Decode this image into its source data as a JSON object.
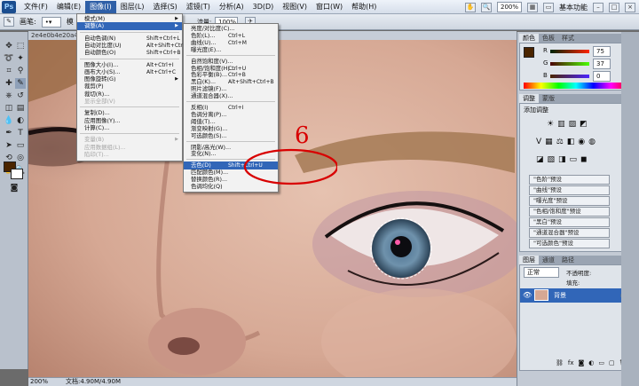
{
  "app": {
    "logo": "Ps"
  },
  "menubar": {
    "items": [
      "文件(F)",
      "编辑(E)",
      "图像(I)",
      "图层(L)",
      "选择(S)",
      "滤镜(T)",
      "分析(A)",
      "3D(D)",
      "视图(V)",
      "窗口(W)",
      "帮助(H)"
    ],
    "active_index": 2,
    "zoom": "200%",
    "workspace": "基本功能"
  },
  "options_bar": {
    "brush_label": "画笔:",
    "mode_label": "模",
    "flow_label": "流量:",
    "flow_value": "100%"
  },
  "document": {
    "tab": "2e4e0b4e20a446",
    "status_zoom": "200%",
    "status_doc": "文档:4.90M/4.90M"
  },
  "annotation": {
    "step": "6"
  },
  "image_menu": [
    {
      "label": "模式(M)",
      "shortcut": "",
      "arrow": true,
      "state": "normal"
    },
    {
      "label": "调整(A)",
      "shortcut": "",
      "arrow": true,
      "state": "highlight"
    },
    {
      "label": "自动色调(N)",
      "shortcut": "Shift+Ctrl+L",
      "state": "normal"
    },
    {
      "label": "自动对比度(U)",
      "shortcut": "Alt+Shift+Ctrl+L",
      "state": "normal"
    },
    {
      "label": "自动颜色(O)",
      "shortcut": "Shift+Ctrl+B",
      "state": "normal"
    },
    {
      "label": "图像大小(I)...",
      "shortcut": "Alt+Ctrl+I",
      "state": "normal"
    },
    {
      "label": "画布大小(S)...",
      "shortcut": "Alt+Ctrl+C",
      "state": "normal"
    },
    {
      "label": "图像旋转(G)",
      "shortcut": "",
      "arrow": true,
      "state": "normal"
    },
    {
      "label": "裁剪(P)",
      "shortcut": "",
      "state": "normal"
    },
    {
      "label": "裁切(R)...",
      "shortcut": "",
      "state": "normal"
    },
    {
      "label": "显示全部(V)",
      "shortcut": "",
      "state": "disabled"
    },
    {
      "label": "复制(D)...",
      "shortcut": "",
      "state": "normal"
    },
    {
      "label": "应用图像(Y)...",
      "shortcut": "",
      "state": "normal"
    },
    {
      "label": "计算(C)...",
      "shortcut": "",
      "state": "normal"
    },
    {
      "label": "变量(B)",
      "shortcut": "",
      "arrow": true,
      "state": "disabled"
    },
    {
      "label": "应用数据组(L)...",
      "shortcut": "",
      "state": "disabled"
    },
    {
      "label": "陷印(T)...",
      "shortcut": "",
      "state": "disabled"
    }
  ],
  "adjust_menu": [
    {
      "label": "亮度/对比度(C)...",
      "shortcut": "",
      "state": "normal"
    },
    {
      "label": "色阶(L)...",
      "shortcut": "Ctrl+L",
      "state": "normal"
    },
    {
      "label": "曲线(U)...",
      "shortcut": "Ctrl+M",
      "state": "normal"
    },
    {
      "label": "曝光度(E)...",
      "shortcut": "",
      "state": "normal"
    },
    {
      "label": "自然饱和度(V)...",
      "shortcut": "",
      "state": "normal"
    },
    {
      "label": "色相/饱和度(H)...",
      "shortcut": "Ctrl+U",
      "state": "normal"
    },
    {
      "label": "色彩平衡(B)...",
      "shortcut": "Ctrl+B",
      "state": "normal"
    },
    {
      "label": "黑白(K)...",
      "shortcut": "Alt+Shift+Ctrl+B",
      "state": "normal"
    },
    {
      "label": "照片滤镜(F)...",
      "shortcut": "",
      "state": "normal"
    },
    {
      "label": "通道混合器(X)...",
      "shortcut": "",
      "state": "normal"
    },
    {
      "label": "反相(I)",
      "shortcut": "Ctrl+I",
      "state": "normal"
    },
    {
      "label": "色调分离(P)...",
      "shortcut": "",
      "state": "normal"
    },
    {
      "label": "阈值(T)...",
      "shortcut": "",
      "state": "normal"
    },
    {
      "label": "渐变映射(G)...",
      "shortcut": "",
      "state": "normal"
    },
    {
      "label": "可选颜色(S)...",
      "shortcut": "",
      "state": "normal"
    },
    {
      "label": "阴影/高光(W)...",
      "shortcut": "",
      "state": "normal"
    },
    {
      "label": "变化(N)...",
      "shortcut": "",
      "state": "normal"
    },
    {
      "label": "去色(D)",
      "shortcut": "Shift+Ctrl+U",
      "state": "highlight"
    },
    {
      "label": "匹配颜色(M)...",
      "shortcut": "",
      "state": "normal"
    },
    {
      "label": "替换颜色(R)...",
      "shortcut": "",
      "state": "normal"
    },
    {
      "label": "色调均化(Q)",
      "shortcut": "",
      "state": "normal"
    }
  ],
  "color_panel": {
    "tabs": [
      "颜色",
      "色板",
      "样式"
    ],
    "r": "75",
    "g": "37",
    "b": "0",
    "fg_color": "#4b2500"
  },
  "adjust_panel": {
    "tabs": [
      "调整",
      "蒙版"
    ],
    "title": "添加调整",
    "presets": [
      "\"色阶\"预设",
      "\"曲线\"预设",
      "\"曝光度\"预设",
      "\"色相/饱和度\"预设",
      "\"黑白\"预设",
      "\"通道混合器\"预设",
      "\"可选颜色\"预设"
    ]
  },
  "layers_panel": {
    "tabs": [
      "图层",
      "通道",
      "路径"
    ],
    "blend_mode": "正常",
    "opacity_label": "不透明度:",
    "fill_label": "填充:",
    "layer_name": "背景"
  },
  "colors": {
    "accent": "#3166b8",
    "annotation": "#d80000"
  }
}
